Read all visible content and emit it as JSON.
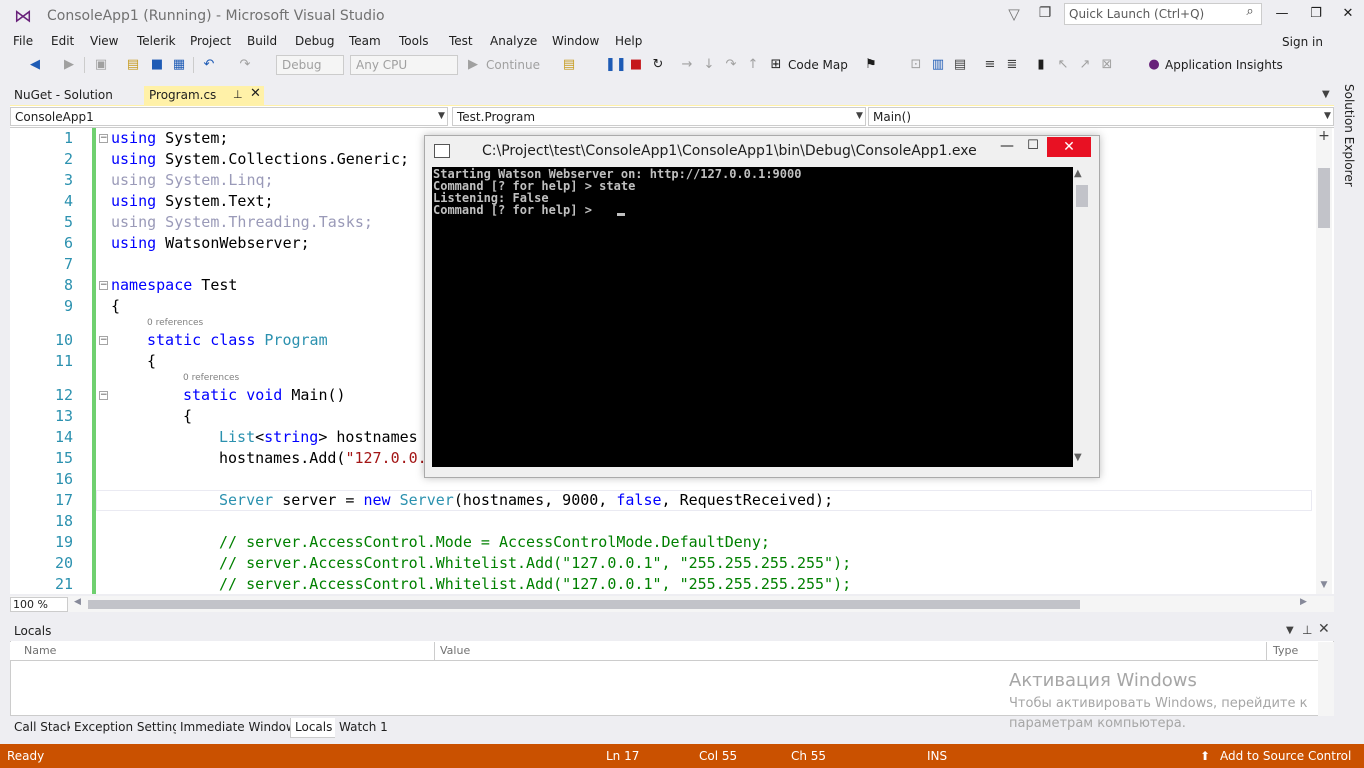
{
  "window": {
    "title": "ConsoleApp1 (Running) - Microsoft Visual Studio",
    "quick_launch_placeholder": "Quick Launch (Ctrl+Q)",
    "sign_in": "Sign in"
  },
  "menu": [
    "File",
    "Edit",
    "View",
    "Telerik",
    "Project",
    "Build",
    "Debug",
    "Team",
    "Tools",
    "Test",
    "Analyze",
    "Window",
    "Help"
  ],
  "toolbar": {
    "config": "Debug",
    "platform": "Any CPU",
    "continue": "Continue",
    "code_map": "Code Map",
    "app_insights": "Application Insights"
  },
  "tabs": {
    "solution": "NuGet - Solution",
    "active_file": "Program.cs"
  },
  "navbar": {
    "project": "ConsoleApp1",
    "class": "Test.Program",
    "member": "Main()"
  },
  "editor": {
    "line_numbers": [
      "1",
      "2",
      "3",
      "4",
      "5",
      "6",
      "7",
      "8",
      "9",
      "10",
      "11",
      "12",
      "13",
      "14",
      "15",
      "16",
      "17",
      "18",
      "19",
      "20",
      "21"
    ],
    "references_label": "0 references",
    "zoom": "100 %",
    "lines": {
      "l1_kw": "using",
      "l1_rest": " System;",
      "l2_kw": "using",
      "l2_rest": " System.Collections.Generic;",
      "l3": "using System.Linq;",
      "l4_kw": "using",
      "l4_rest": " System.Text;",
      "l5": "using System.Threading.Tasks;",
      "l6_kw": "using",
      "l6_rest": " WatsonWebserver;",
      "l8_kw": "namespace",
      "l8_rest": " Test",
      "l9": "{",
      "l10_kw": "static class",
      "l10_ty": "Program",
      "l11": "{",
      "l12_kw": "static void",
      "l12_rest": " Main()",
      "l13": "{",
      "l14_ty": "List",
      "l14_a": "<",
      "l14_kw": "string",
      "l14_b": "> hostnames",
      "l15_a": "hostnames.Add(",
      "l15_st": "\"127.0.0.",
      "l17_ty1": "Server",
      "l17_a": " server = ",
      "l17_kw1": "new",
      "l17_sp": " ",
      "l17_ty2": "Server",
      "l17_b": "(hostnames, 9000, ",
      "l17_kw2": "false",
      "l17_c": ", RequestReceived);",
      "l19": "// server.AccessControl.Mode = AccessControlMode.DefaultDeny;",
      "l20": "// server.AccessControl.Whitelist.Add(\"127.0.0.1\", \"255.255.255.255\");",
      "l21": "// server.AccessControl.Whitelist.Add(\"127.0.0.1\", \"255.255.255.255\");"
    }
  },
  "console": {
    "title": "C:\\Project\\test\\ConsoleApp1\\ConsoleApp1\\bin\\Debug\\ConsoleApp1.exe",
    "lines": [
      "Starting Watson Webserver on: http://127.0.0.1:9000",
      "Command [? for help] > state",
      "Listening: False",
      "Command [? for help] > "
    ]
  },
  "side_panel": {
    "solution_explorer": "Solution Explorer"
  },
  "locals": {
    "title": "Locals",
    "columns": [
      "Name",
      "Value",
      "Type"
    ]
  },
  "bottom_tabs": [
    "Call Stack",
    "Exception Settings",
    "Immediate Window",
    "Locals",
    "Watch 1"
  ],
  "watermark": {
    "line1": "Активация Windows",
    "line2": "Чтобы активировать Windows, перейдите к",
    "line3": "параметрам компьютера."
  },
  "statusbar": {
    "ready": "Ready",
    "ln": "Ln 17",
    "col": "Col 55",
    "ch": "Ch 55",
    "ins": "INS",
    "source_control": "Add to Source Control"
  },
  "colors": {
    "statusbar": "#ca5100",
    "active_tab": "#fff1a8",
    "keyword": "#0000ff",
    "type": "#2b91af",
    "comment": "#008000",
    "string": "#a31515"
  }
}
